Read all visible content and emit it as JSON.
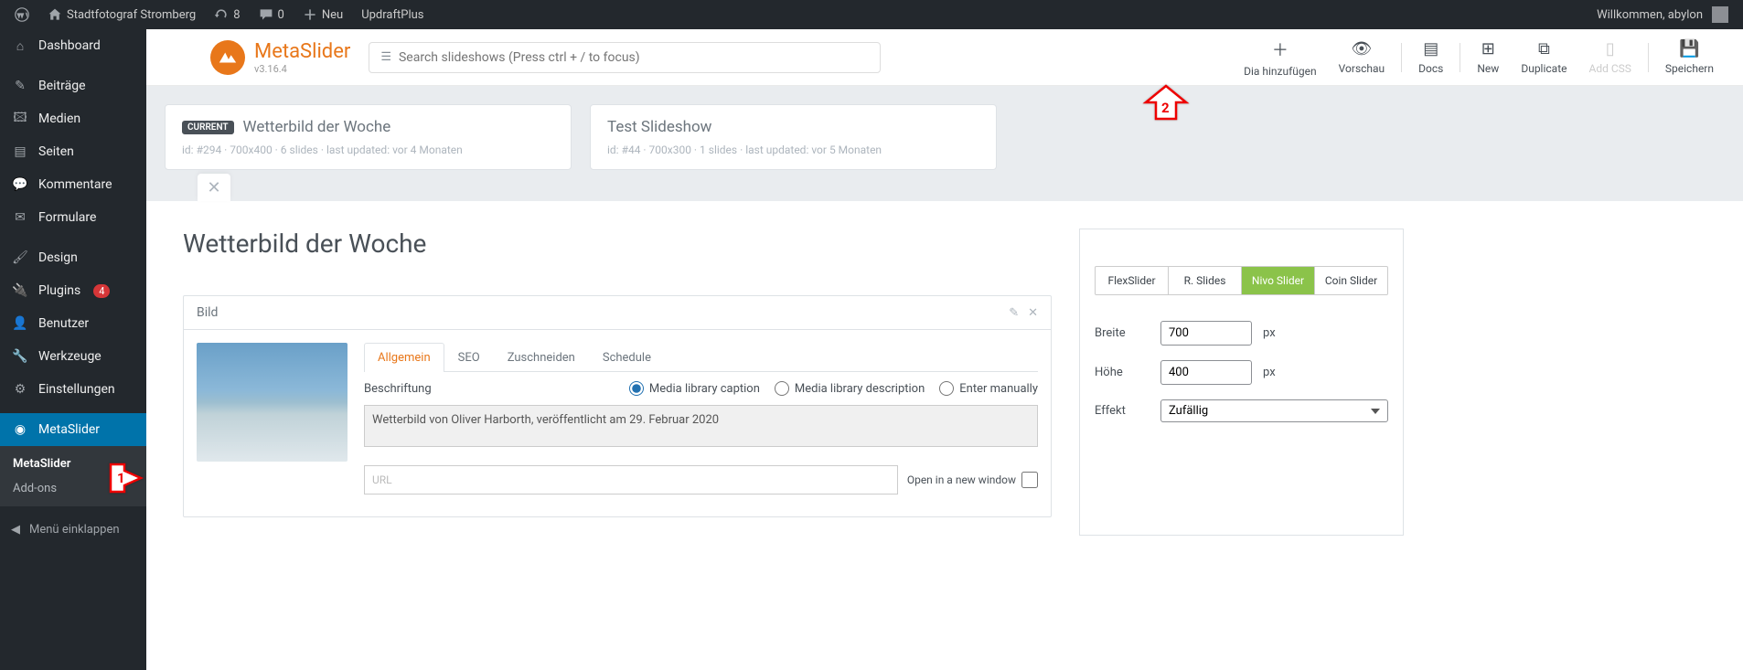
{
  "adminbar": {
    "site_name": "Stadtfotograf Stromberg",
    "updates": "8",
    "comments": "0",
    "new_label": "Neu",
    "updraft": "UpdraftPlus",
    "welcome": "Willkommen, abylon"
  },
  "sidebar": {
    "dashboard": "Dashboard",
    "posts": "Beiträge",
    "media": "Medien",
    "pages": "Seiten",
    "comments": "Kommentare",
    "forms": "Formulare",
    "design": "Design",
    "plugins": "Plugins",
    "plugins_badge": "4",
    "users": "Benutzer",
    "tools": "Werkzeuge",
    "settings": "Einstellungen",
    "metaslider": "MetaSlider",
    "submenu_metaslider": "MetaSlider",
    "submenu_addons": "Add-ons",
    "collapse": "Menü einklappen"
  },
  "header": {
    "product": "MetaSlider",
    "version": "v3.16.4",
    "search_placeholder": "Search slideshows (Press ctrl + / to focus)",
    "actions": {
      "add_slide": "Dia hinzufügen",
      "preview": "Vorschau",
      "docs": "Docs",
      "new": "New",
      "duplicate": "Duplicate",
      "add_css": "Add CSS",
      "save": "Speichern"
    }
  },
  "cards": [
    {
      "badge": "CURRENT",
      "title": "Wetterbild der Woche",
      "meta": "id: #294 · 700x400 · 6 slides · last updated: vor 4 Monaten"
    },
    {
      "badge": "",
      "title": "Test Slideshow",
      "meta": "id: #44 · 700x300 · 1 slides · last updated: vor 5 Monaten"
    }
  ],
  "editor": {
    "title": "Wetterbild der Woche",
    "slide_header": "Bild",
    "tabs": {
      "general": "Allgemein",
      "seo": "SEO",
      "crop": "Zuschneiden",
      "schedule": "Schedule"
    },
    "caption_label": "Beschriftung",
    "radio": {
      "media_caption": "Media library caption",
      "media_desc": "Media library description",
      "manual": "Enter manually"
    },
    "caption_text": "Wetterbild von Oliver Harborth, veröffentlicht am 29. Februar 2020",
    "url_label": "URL",
    "open_new": "Open in a new window"
  },
  "settings": {
    "types": {
      "flex": "FlexSlider",
      "r": "R. Slides",
      "nivo": "Nivo Slider",
      "coin": "Coin Slider"
    },
    "width_label": "Breite",
    "width": "700",
    "height_label": "Höhe",
    "height": "400",
    "px": "px",
    "effect_label": "Effekt",
    "effect": "Zufällig"
  },
  "annotations": {
    "one": "1",
    "two": "2"
  }
}
